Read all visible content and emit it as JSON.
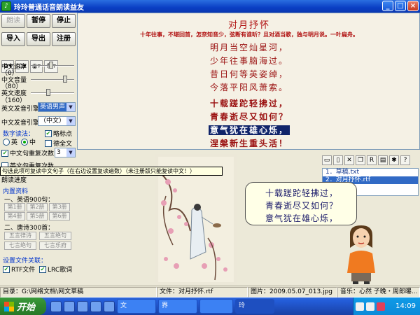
{
  "window": {
    "title": "玲玲普通话音朗读益友",
    "icon": "app-icon",
    "buttons": {
      "minimize": "_",
      "maximize": "□",
      "close": "×"
    }
  },
  "toolbar": {
    "read": "朗读",
    "pause": "暂停",
    "stop": "停止",
    "import": "导入",
    "export": "导出",
    "register": "注册"
  },
  "icon_row": [
    "flower-icon",
    "voice-select-icon",
    "disc-icon",
    "user-icon"
  ],
  "sliders": {
    "rate_label": "中文速率",
    "rate_value": "（0）",
    "volume_label": "中文音量",
    "volume_value": "（80）",
    "en_speed_label": "英文速度",
    "en_speed_value": "（160）"
  },
  "voices": {
    "en_label": "英文发音引擎",
    "en_value": "英语男声",
    "cn_label": "中文发音引擎",
    "cn_value": "（中文）"
  },
  "digit_mode": {
    "title": "数字读法：",
    "english": "英",
    "chinese": "中",
    "punct": "略标点",
    "de_whole": "德全文"
  },
  "repeat": {
    "cn_label": "中文句重复次数",
    "cn_value": "3",
    "en_label": "英文句重复次数",
    "progress": "朗读进度"
  },
  "tooltip": "勾选此项可复读中文句子（在右边设置复读遍数）（未注册版只能复读中文！）",
  "library": {
    "title": "内置资料",
    "section1": "一、英语900句：",
    "grades": [
      "第1册",
      "第2册",
      "第3册",
      "第4册",
      "第5册",
      "第6册"
    ],
    "section2": "二、唐诗300首：",
    "poems": [
      "五言律诗",
      "五言绝句",
      "七言绝句",
      "七言乐府"
    ]
  },
  "assoc": {
    "title": "设置文件关联：",
    "rtf": "RTF文件",
    "lrc": "LRC歌词"
  },
  "poem": {
    "title": "对月抒怀",
    "intro": "十年往事，不堪回首，怎奈知音少，弦断有谁听？且对酒当歌，独与明月说。一叶扁舟。",
    "lines": [
      "明月当空灿星河，",
      "少年往事脑海过。",
      "昔日何等英姿绰，",
      "今落平阳风萧索。",
      "十载蹉跎轻拂过，",
      "青春逝尽又如何？",
      "意气犹在雄心烁，",
      "涅槃新生重头活！"
    ]
  },
  "files": [
    "1．草稿.txt",
    "2．对月抒怀.rtf"
  ],
  "bubble_lines": [
    "十载蹉跎轻拂过，",
    "青春逝尽又如何？",
    "意气犹在雄心烁，"
  ],
  "status": {
    "dir": "目录：G:\\网络文档\\网文草稿",
    "file": "文件：对月抒怀.rtf",
    "image": "图片：2009.05.07_013.jpg",
    "music": "音乐：心然 子晚・周郎曝..."
  },
  "taskbar": {
    "start": "开始",
    "tasks": [
      "文",
      "界",
      "玲"
    ],
    "clock": "14:09"
  },
  "colors": {
    "title_blue": "#0a3fc4",
    "poem_red": "#9a1010",
    "highlight": "#10246a",
    "start_green": "#2f8a2f"
  }
}
